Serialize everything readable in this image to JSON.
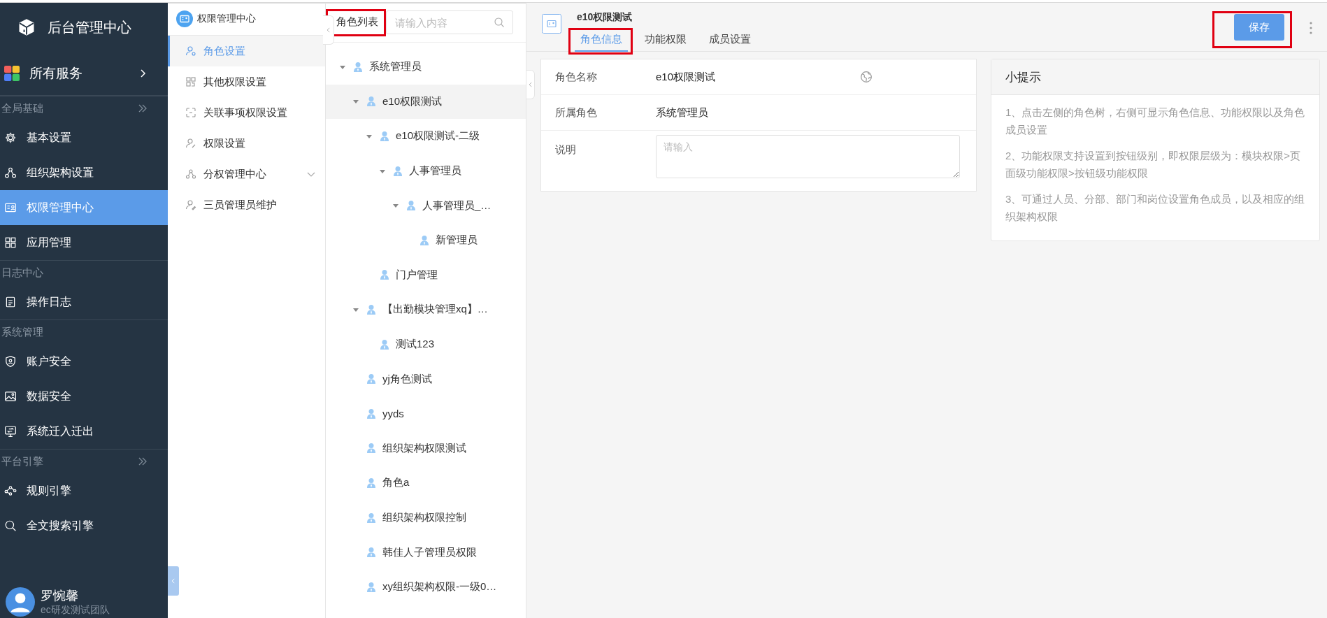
{
  "app": {
    "title": "后台管理中心"
  },
  "all_services": {
    "label": "所有服务"
  },
  "sidebar": {
    "sections": [
      {
        "title": "全局基础",
        "collapsible": true,
        "items": [
          {
            "label": "基本设置",
            "selected": false
          },
          {
            "label": "组织架构设置",
            "selected": false
          },
          {
            "label": "权限管理中心",
            "selected": true
          },
          {
            "label": "应用管理",
            "selected": false
          }
        ]
      },
      {
        "title": "日志中心",
        "collapsible": false,
        "items": [
          {
            "label": "操作日志",
            "selected": false
          }
        ]
      },
      {
        "title": "系统管理",
        "collapsible": false,
        "items": [
          {
            "label": "账户安全",
            "selected": false
          },
          {
            "label": "数据安全",
            "selected": false
          },
          {
            "label": "系统迁入迁出",
            "selected": false
          }
        ]
      },
      {
        "title": "平台引擎",
        "collapsible": true,
        "items": [
          {
            "label": "规则引擎",
            "selected": false
          },
          {
            "label": "全文搜索引擎",
            "selected": false
          }
        ]
      }
    ]
  },
  "user": {
    "name": "罗惋馨",
    "team": "ec研发测试团队"
  },
  "submenu": {
    "title": "权限管理中心",
    "items": [
      {
        "label": "角色设置",
        "selected": true,
        "expandable": false
      },
      {
        "label": "其他权限设置",
        "selected": false,
        "expandable": false
      },
      {
        "label": "关联事项权限设置",
        "selected": false,
        "expandable": false
      },
      {
        "label": "权限设置",
        "selected": false,
        "expandable": false
      },
      {
        "label": "分权管理中心",
        "selected": false,
        "expandable": true
      },
      {
        "label": "三员管理员维护",
        "selected": false,
        "expandable": false
      }
    ]
  },
  "role_tree": {
    "label": "角色列表",
    "highlighted": true,
    "search": {
      "placeholder": "请输入内容"
    },
    "items": [
      {
        "label": "系统管理员",
        "selected": false,
        "expanded": true,
        "children": [
          {
            "label": "e10权限测试",
            "selected": true,
            "expanded": true,
            "children": [
              {
                "label": "e10权限测试-二级",
                "selected": false,
                "expanded": true,
                "children": [
                  {
                    "label": "人事管理员",
                    "selected": false,
                    "expanded": true,
                    "children": [
                      {
                        "label": "人事管理员_…",
                        "selected": false,
                        "expanded": true,
                        "children": [
                          {
                            "label": "新管理员",
                            "selected": false
                          }
                        ]
                      }
                    ]
                  }
                ]
              },
              {
                "label": "门户管理",
                "selected": false
              }
            ]
          },
          {
            "label": "【出勤模块管理xq】…",
            "selected": false,
            "expanded": true,
            "children": [
              {
                "label": "测试123",
                "selected": false
              }
            ]
          },
          {
            "label": "yj角色测试",
            "selected": false
          },
          {
            "label": "yyds",
            "selected": false
          },
          {
            "label": "组织架构权限测试",
            "selected": false
          },
          {
            "label": "角色a",
            "selected": false
          },
          {
            "label": "组织架构权限控制",
            "selected": false
          },
          {
            "label": "韩佳人子管理员权限",
            "selected": false
          },
          {
            "label": "xy组织架构权限-一级0…",
            "selected": false
          }
        ]
      }
    ]
  },
  "detail": {
    "title": "e10权限测试",
    "tabs": [
      {
        "label": "角色信息",
        "selected": true,
        "highlighted": true
      },
      {
        "label": "功能权限",
        "selected": false,
        "highlighted": false
      },
      {
        "label": "成员设置",
        "selected": false,
        "highlighted": false
      }
    ],
    "save_button": {
      "label": "保存",
      "highlighted": true
    },
    "fields": [
      {
        "kind": "text",
        "label": "角色名称",
        "value": "e10权限测试",
        "multilingual": true
      },
      {
        "kind": "text",
        "label": "所属角色",
        "value": "系统管理员",
        "multilingual": false
      },
      {
        "kind": "textarea",
        "label": "说明",
        "placeholder": "请输入"
      }
    ]
  },
  "tips": {
    "title": "小提示",
    "items": [
      "1、点击左侧的角色树，右侧可显示角色信息、功能权限以及角色成员设置",
      "2、功能权限支持设置到按钮级别，即权限层级为：模块权限>页面级功能权限>按钮级功能权限",
      "3、可通过人员、分部、部门和岗位设置角色成员，以及相应的组织架构权限"
    ]
  }
}
